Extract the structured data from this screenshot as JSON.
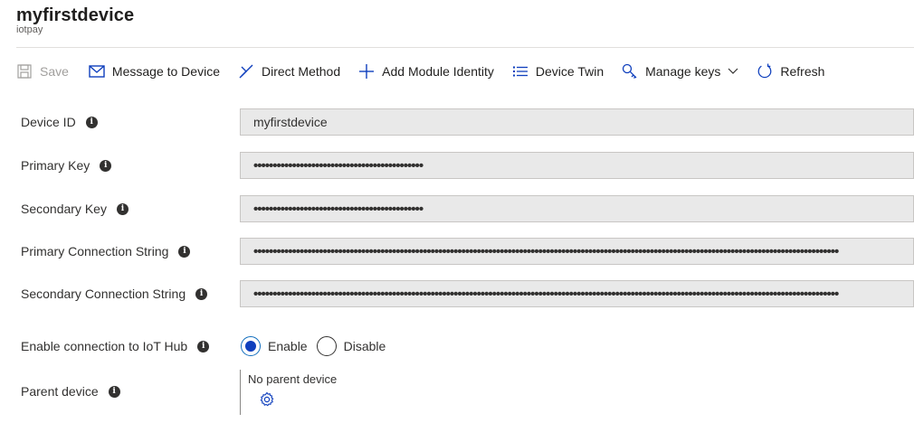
{
  "header": {
    "title": "myfirstdevice",
    "subtitle": "iotpay"
  },
  "toolbar": {
    "save": "Save",
    "message": "Message to Device",
    "direct": "Direct Method",
    "module": "Add Module Identity",
    "twin": "Device Twin",
    "keys": "Manage keys",
    "refresh": "Refresh"
  },
  "form": {
    "device_id": {
      "label": "Device ID",
      "value": "myfirstdevice"
    },
    "primary_key": {
      "label": "Primary Key",
      "value": "••••••••••••••••••••••••••••••••••••••••••••"
    },
    "secondary_key": {
      "label": "Secondary Key",
      "value": "••••••••••••••••••••••••••••••••••••••••••••"
    },
    "primary_conn": {
      "label": "Primary Connection String",
      "value": "••••••••••••••••••••••••••••••••••••••••••••••••••••••••••••••••••••••••••••••••••••••••••••••••••••••••••••••••••••••••••••••••••••••••••••••••••••••••"
    },
    "secondary_conn": {
      "label": "Secondary Connection String",
      "value": "••••••••••••••••••••••••••••••••••••••••••••••••••••••••••••••••••••••••••••••••••••••••••••••••••••••••••••••••••••••••••••••••••••••••••••••••••••••••"
    },
    "enable_conn": {
      "label": "Enable connection to IoT Hub",
      "enable": "Enable",
      "disable": "Disable",
      "selected": "Enable"
    },
    "parent": {
      "label": "Parent device",
      "value": "No parent device"
    }
  },
  "colors": {
    "accent": "#0f3fbd",
    "field_bg": "#e9e9e9",
    "text": "#323130"
  }
}
